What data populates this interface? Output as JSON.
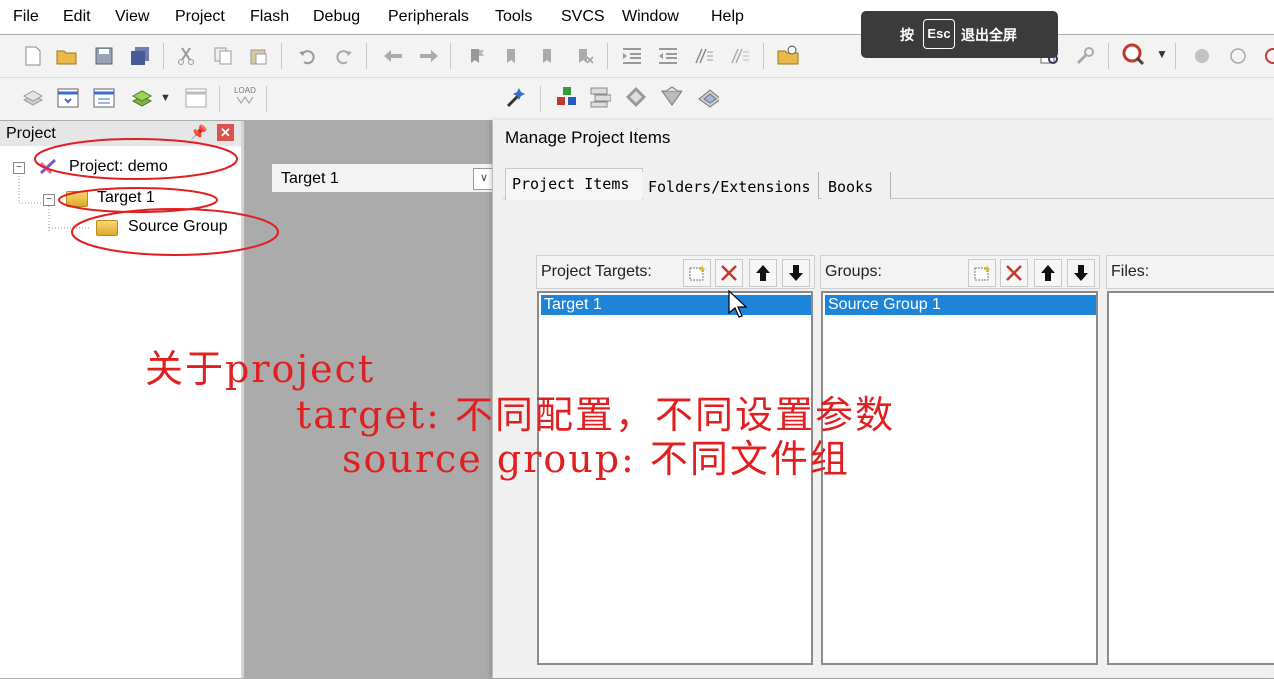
{
  "menubar": {
    "items": [
      "File",
      "Edit",
      "View",
      "Project",
      "Flash",
      "Debug",
      "Peripherals",
      "Tools",
      "SVCS",
      "Window",
      "Help"
    ]
  },
  "fullscreen_hint": {
    "press": "按",
    "key": "Esc",
    "action": "退出全屏"
  },
  "toolbar2": {
    "target_combo": "Target 1",
    "load_label": "LOAD"
  },
  "project_panel": {
    "title": "Project",
    "tree": {
      "project": "Project: demo",
      "target": "Target 1",
      "group": "Source Group"
    }
  },
  "dialog": {
    "title": "Manage Project Items",
    "tabs": [
      "Project Items",
      "Folders/Extensions",
      "Books"
    ],
    "targets_label": "Project Targets:",
    "targets": [
      "Target 1"
    ],
    "groups_label": "Groups:",
    "groups": [
      "Source Group 1"
    ],
    "files_label": "Files:"
  },
  "annotations": {
    "line1": "关于project",
    "line2": "target: 不同配置，不同设置参数",
    "line3": "source group: 不同文件组",
    "color": "#e02020"
  }
}
